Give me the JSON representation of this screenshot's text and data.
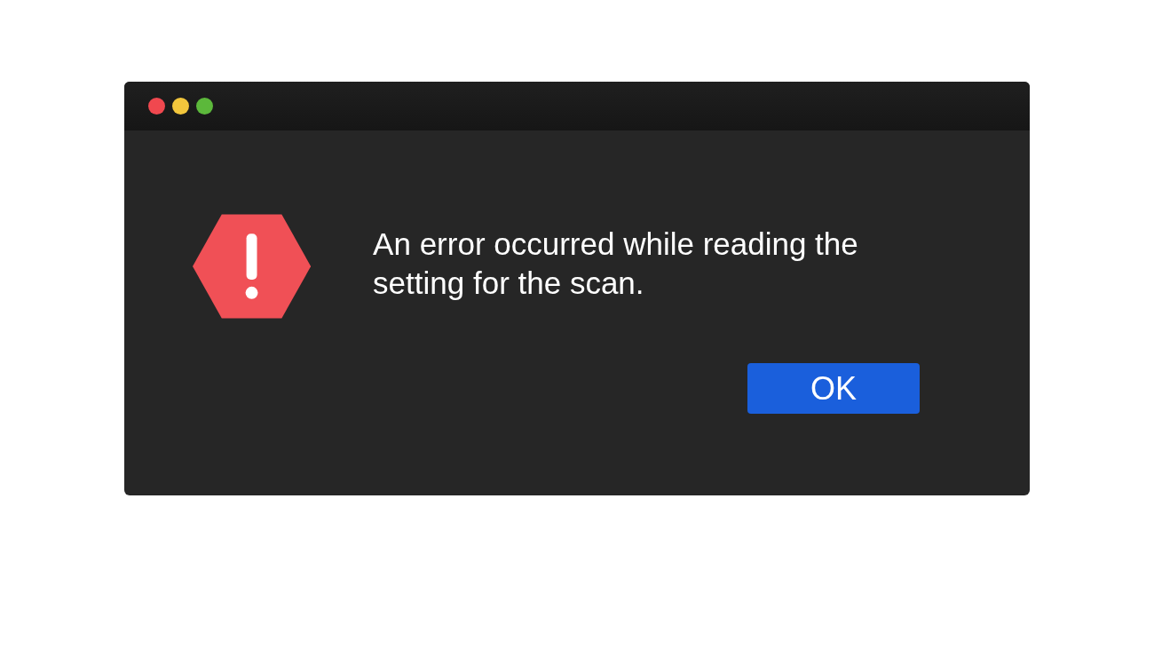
{
  "dialog": {
    "message": "An error occurred while reading the setting for the scan.",
    "buttons": [
      {
        "label": "OK",
        "kind": "primary"
      }
    ]
  }
}
